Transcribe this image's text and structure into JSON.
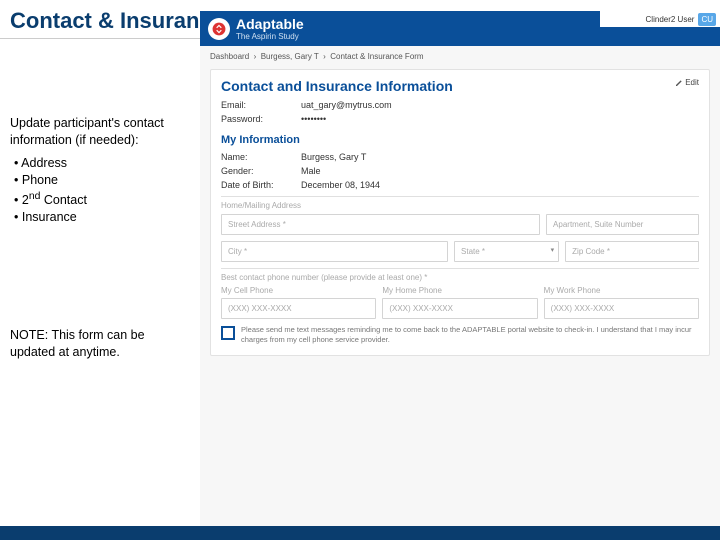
{
  "slide": {
    "title": "Contact & Insurance Form",
    "instruction": "Update participant's contact information (if needed):",
    "bullets": [
      "Address",
      "Phone",
      "2nd Contact",
      "Insurance"
    ],
    "note": "NOTE: This form can be updated at anytime."
  },
  "app": {
    "brand": {
      "name": "Adaptable",
      "subtitle": "The Aspirin Study"
    },
    "user": {
      "label": "Clinder2 User",
      "initials": "CU"
    },
    "breadcrumb": [
      "Dashboard",
      "Burgess, Gary T",
      "Contact & Insurance Form"
    ],
    "card": {
      "title": "Contact and Insurance Information",
      "edit": "Edit",
      "email": {
        "label": "Email:",
        "value": "uat_gary@mytrus.com"
      },
      "password": {
        "label": "Password:",
        "value": "••••••••"
      },
      "myinfo_title": "My Information",
      "name": {
        "label": "Name:",
        "value": "Burgess, Gary T"
      },
      "gender": {
        "label": "Gender:",
        "value": "Male"
      },
      "dob": {
        "label": "Date of Birth:",
        "value": "December 08, 1944"
      },
      "address_section_label": "Home/Mailing Address",
      "inputs": {
        "street": "Street Address *",
        "apt": "Apartment, Suite Number",
        "city": "City *",
        "state": "State *",
        "zip": "Zip Code *"
      },
      "phone_section_label": "Best contact phone number (please provide at least one) *",
      "phone": {
        "cell_label": "My Cell Phone",
        "home_label": "My Home Phone",
        "work_label": "My Work Phone",
        "placeholder": "(XXX) XXX-XXXX"
      },
      "consent": "Please send me text messages reminding me to come back to the ADAPTABLE portal website to check-in. I understand that I may incur charges from my cell phone service provider."
    }
  }
}
